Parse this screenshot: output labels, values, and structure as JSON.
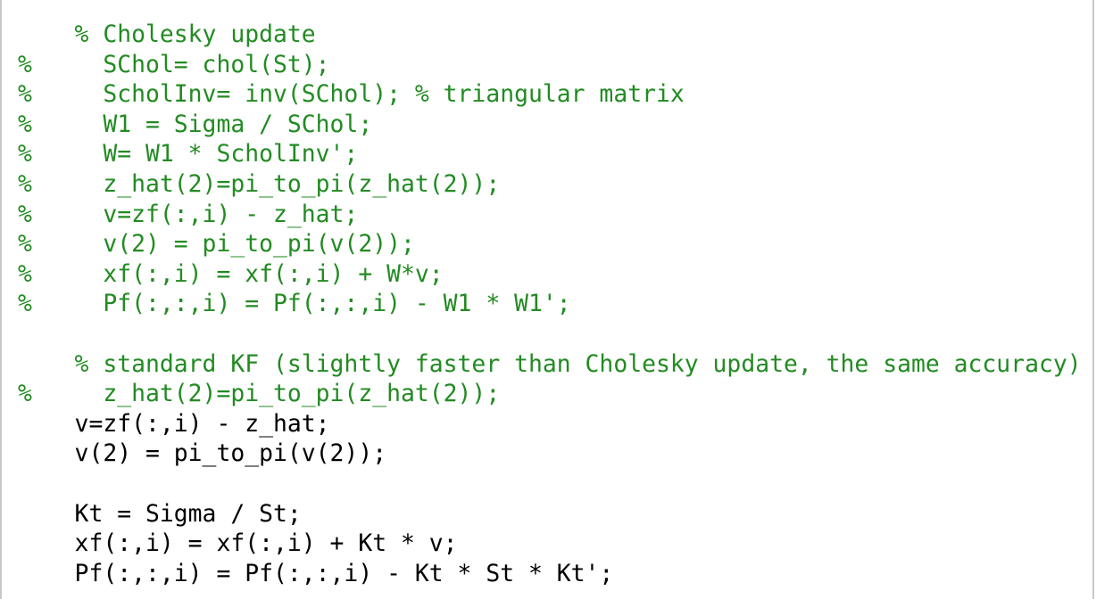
{
  "colors": {
    "comment": "#228b22",
    "code": "#000000",
    "background": "#ffffff",
    "border": "#c8c8c8"
  },
  "editor": {
    "lines": [
      {
        "text": "    % Cholesky update",
        "kind": "comment"
      },
      {
        "text": "%     SChol= chol(St);",
        "kind": "comment"
      },
      {
        "text": "%     ScholInv= inv(SChol); % triangular matrix",
        "kind": "comment"
      },
      {
        "text": "%     W1 = Sigma / SChol;",
        "kind": "comment"
      },
      {
        "text": "%     W= W1 * ScholInv';",
        "kind": "comment"
      },
      {
        "text": "%     z_hat(2)=pi_to_pi(z_hat(2));",
        "kind": "comment"
      },
      {
        "text": "%     v=zf(:,i) - z_hat;",
        "kind": "comment"
      },
      {
        "text": "%     v(2) = pi_to_pi(v(2));",
        "kind": "comment"
      },
      {
        "text": "%     xf(:,i) = xf(:,i) + W*v;",
        "kind": "comment"
      },
      {
        "text": "%     Pf(:,:,i) = Pf(:,:,i) - W1 * W1';",
        "kind": "comment"
      },
      {
        "text": "",
        "kind": "code"
      },
      {
        "text": "    % standard KF (slightly faster than Cholesky update, the same accuracy)",
        "kind": "comment"
      },
      {
        "text": "%     z_hat(2)=pi_to_pi(z_hat(2));",
        "kind": "comment"
      },
      {
        "text": "    v=zf(:,i) - z_hat;",
        "kind": "code"
      },
      {
        "text": "    v(2) = pi_to_pi(v(2));",
        "kind": "code"
      },
      {
        "text": "",
        "kind": "code"
      },
      {
        "text": "    Kt = Sigma / St;",
        "kind": "code"
      },
      {
        "text": "    xf(:,i) = xf(:,i) + Kt * v;",
        "kind": "code"
      },
      {
        "text": "    Pf(:,:,i) = Pf(:,:,i) - Kt * St * Kt';",
        "kind": "code"
      }
    ]
  }
}
